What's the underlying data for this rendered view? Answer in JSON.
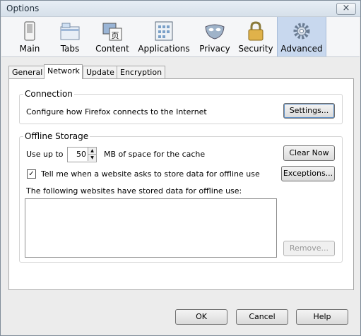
{
  "window": {
    "title": "Options",
    "close_glyph": "×"
  },
  "toolbar": {
    "items": [
      {
        "label": "Main",
        "icon": "main-icon"
      },
      {
        "label": "Tabs",
        "icon": "tabs-icon"
      },
      {
        "label": "Content",
        "icon": "content-icon"
      },
      {
        "label": "Applications",
        "icon": "applications-icon"
      },
      {
        "label": "Privacy",
        "icon": "privacy-icon"
      },
      {
        "label": "Security",
        "icon": "security-icon"
      },
      {
        "label": "Advanced",
        "icon": "advanced-icon",
        "selected": true
      }
    ]
  },
  "subtabs": [
    {
      "label": "General"
    },
    {
      "label": "Network",
      "active": true
    },
    {
      "label": "Update"
    },
    {
      "label": "Encryption"
    }
  ],
  "connection": {
    "group_label": "Connection",
    "description": "Configure how Firefox connects to the Internet",
    "settings_button": "Settings..."
  },
  "offline": {
    "group_label": "Offline Storage",
    "use_up_to_label": "Use up to",
    "cache_value": "50",
    "cache_suffix": "MB of space for the cache",
    "clear_now_button": "Clear Now",
    "tell_me_checked": true,
    "tell_me_label": "Tell me when a website asks to store data for offline use",
    "exceptions_button": "Exceptions...",
    "list_label": "The following websites have stored data for offline use:",
    "remove_button": "Remove..."
  },
  "footer": {
    "ok_button": "OK",
    "cancel_button": "Cancel",
    "help_button": "Help"
  }
}
